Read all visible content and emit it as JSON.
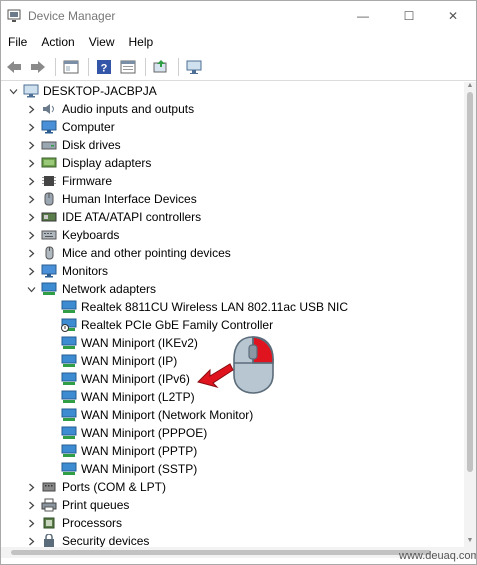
{
  "window": {
    "title": "Device Manager",
    "controls": {
      "minimize": "—",
      "maximize": "☐",
      "close": "✕"
    }
  },
  "menubar": {
    "items": [
      "File",
      "Action",
      "View",
      "Help"
    ]
  },
  "toolbar": {
    "icons": [
      "back-arrow-icon",
      "forward-arrow-icon",
      "properties-icon",
      "help-icon",
      "view-icon",
      "update-driver-icon",
      "scan-hardware-icon"
    ]
  },
  "tree": {
    "root": "DESKTOP-JACBPJA",
    "categories": [
      {
        "label": "Audio inputs and outputs",
        "icon": "speaker-icon",
        "expanded": false
      },
      {
        "label": "Computer",
        "icon": "computer-icon",
        "expanded": false
      },
      {
        "label": "Disk drives",
        "icon": "disk-drive-icon",
        "expanded": false
      },
      {
        "label": "Display adapters",
        "icon": "display-adapter-icon",
        "expanded": false
      },
      {
        "label": "Firmware",
        "icon": "firmware-icon",
        "expanded": false
      },
      {
        "label": "Human Interface Devices",
        "icon": "hid-icon",
        "expanded": false
      },
      {
        "label": "IDE ATA/ATAPI controllers",
        "icon": "ide-controller-icon",
        "expanded": false
      },
      {
        "label": "Keyboards",
        "icon": "keyboard-icon",
        "expanded": false
      },
      {
        "label": "Mice and other pointing devices",
        "icon": "mouse-icon",
        "expanded": false
      },
      {
        "label": "Monitors",
        "icon": "monitor-icon",
        "expanded": false
      },
      {
        "label": "Network adapters",
        "icon": "network-adapter-icon",
        "expanded": true,
        "children": [
          "Realtek 8811CU Wireless LAN 802.11ac USB NIC",
          "Realtek PCIe GbE Family Controller",
          "WAN Miniport (IKEv2)",
          "WAN Miniport (IP)",
          "WAN Miniport (IPv6)",
          "WAN Miniport (L2TP)",
          "WAN Miniport (Network Monitor)",
          "WAN Miniport (PPPOE)",
          "WAN Miniport (PPTP)",
          "WAN Miniport (SSTP)"
        ]
      },
      {
        "label": "Ports (COM & LPT)",
        "icon": "port-icon",
        "expanded": false
      },
      {
        "label": "Print queues",
        "icon": "printer-icon",
        "expanded": false
      },
      {
        "label": "Processors",
        "icon": "processor-icon",
        "expanded": false
      },
      {
        "label": "Security devices",
        "icon": "security-device-icon",
        "expanded": false
      }
    ]
  },
  "overlay": {
    "watermark": "www.deuaq.com"
  },
  "colors": {
    "mouse_red": "#e0141e",
    "arrow_red": "#e0141e",
    "mouse_body": "#b8c6d1",
    "network_green": "#2f9e44",
    "network_blue": "#3d8bd1"
  }
}
